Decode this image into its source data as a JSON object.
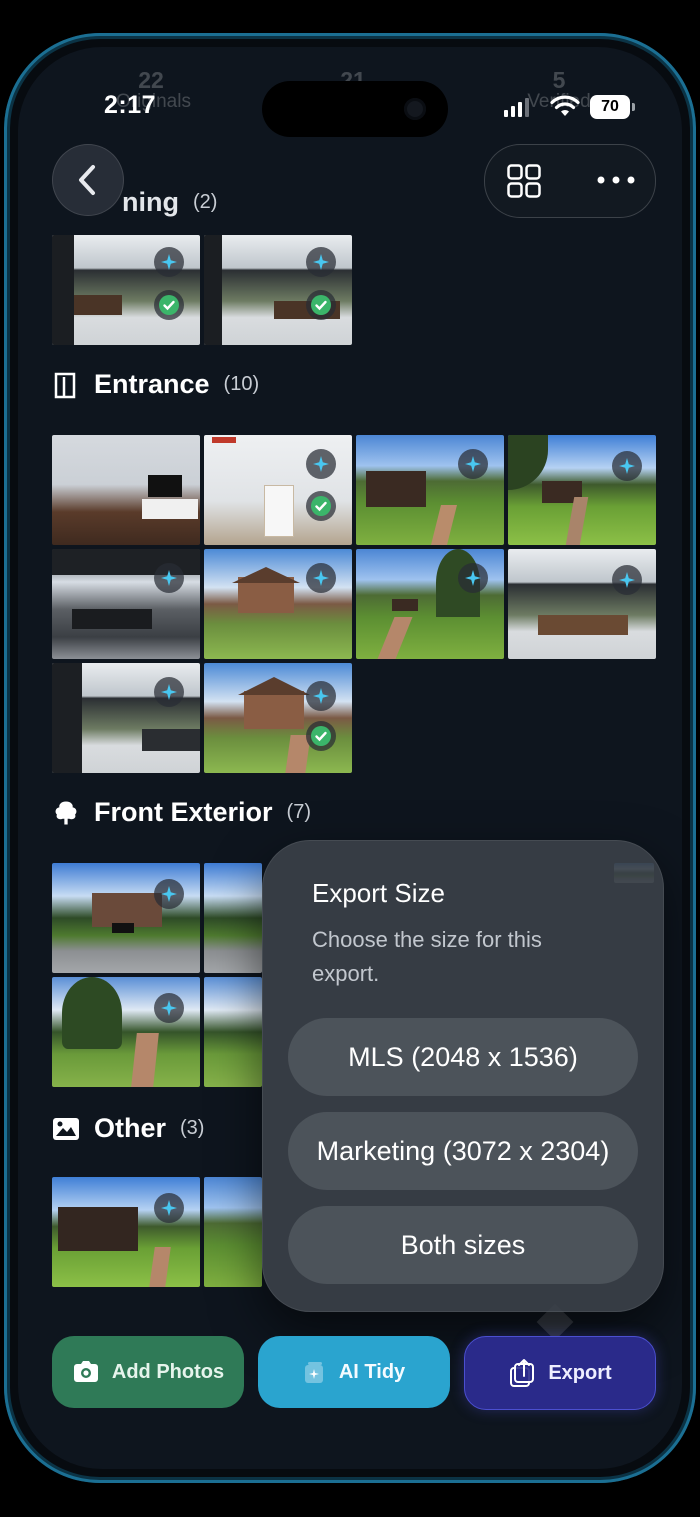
{
  "status_bar": {
    "time": "2:17",
    "battery": "70"
  },
  "stats": [
    {
      "value": "22",
      "label": "Originals"
    },
    {
      "value": "21",
      "label": ""
    },
    {
      "value": "5",
      "label": "Verified"
    }
  ],
  "sections": [
    {
      "title": "ning",
      "count": "(2)",
      "icon": "partial-section"
    },
    {
      "title": "Entrance",
      "count": "(10)",
      "icon": "door-icon"
    },
    {
      "title": "Front Exterior",
      "count": "(7)",
      "icon": "tree-icon"
    },
    {
      "title": "Other",
      "count": "(3)",
      "icon": "image-icon"
    }
  ],
  "export_sheet": {
    "title": "Export Size",
    "subtitle": "Choose the size for this export.",
    "options": [
      "MLS (2048 x 1536)",
      "Marketing (3072 x 2304)",
      "Both sizes"
    ]
  },
  "bottom_bar": {
    "add_photos": "Add Photos",
    "ai_tidy": "AI Tidy",
    "export": "Export"
  },
  "colors": {
    "accent_cyan": "#2aa4cf",
    "add_green": "#2f7a57",
    "export_indigo": "#2a2a8a",
    "check_green": "#3bb56a",
    "sparkle": "#49c7f0"
  }
}
